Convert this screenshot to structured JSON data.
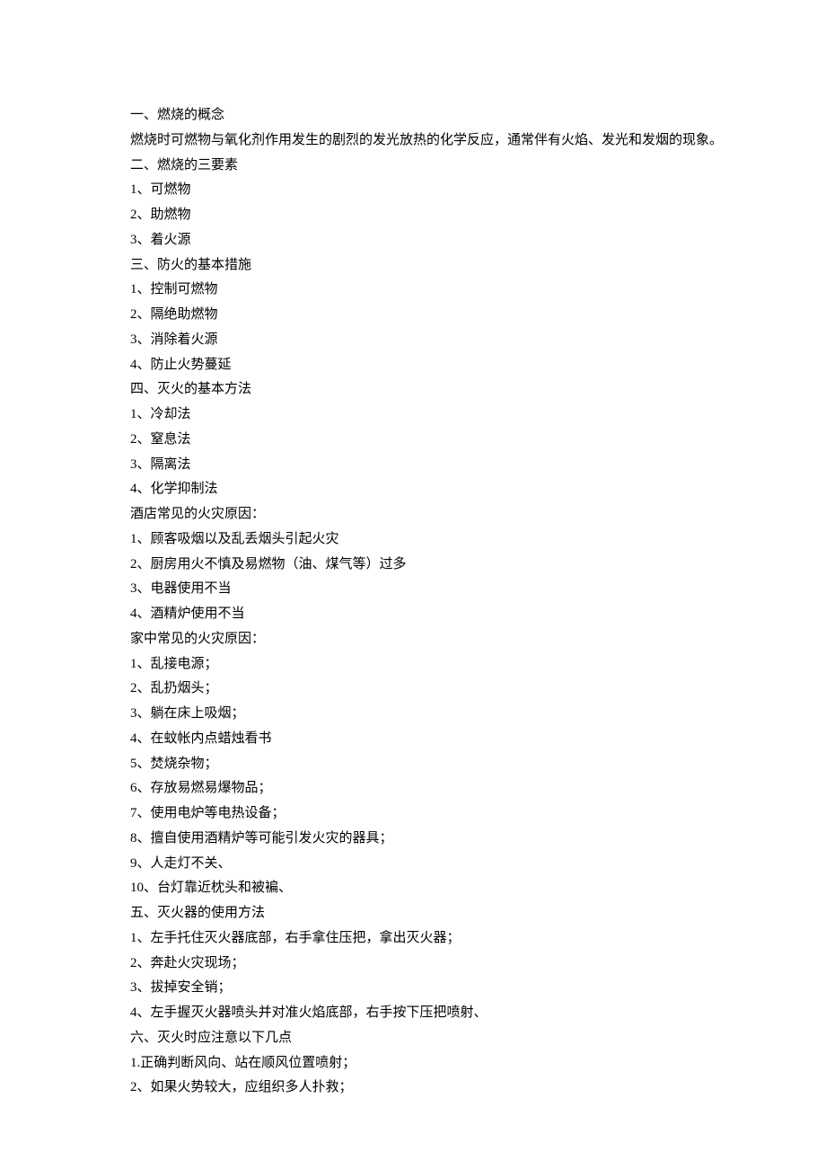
{
  "lines": [
    {
      "text": "一、燃烧的概念",
      "indent": true
    },
    {
      "text": "燃烧时可燃物与氧化剂作用发生的剧烈的发光放热的化学反应，通常伴有火焰、发光和发烟的现象。",
      "indent": true,
      "wrap": true
    },
    {
      "text": "二、燃烧的三要素",
      "indent": true
    },
    {
      "text": "1、可燃物",
      "indent": true
    },
    {
      "text": "2、助燃物",
      "indent": true
    },
    {
      "text": "3、着火源",
      "indent": true
    },
    {
      "text": "三、防火的基本措施",
      "indent": true
    },
    {
      "text": "1、控制可燃物",
      "indent": true
    },
    {
      "text": "2、隔绝助燃物",
      "indent": true
    },
    {
      "text": "3、消除着火源",
      "indent": true
    },
    {
      "text": "4、防止火势蔓延",
      "indent": true
    },
    {
      "text": "四、灭火的基本方法",
      "indent": true
    },
    {
      "text": "1、冷却法",
      "indent": true
    },
    {
      "text": "2、窒息法",
      "indent": true
    },
    {
      "text": "3、隔离法",
      "indent": true
    },
    {
      "text": "4、化学抑制法",
      "indent": true
    },
    {
      "text": "酒店常见的火灾原因：",
      "indent": true
    },
    {
      "text": "1、顾客吸烟以及乱丢烟头引起火灾",
      "indent": true
    },
    {
      "text": "2、厨房用火不慎及易燃物（油、煤气等）过多",
      "indent": true
    },
    {
      "text": "3、电器使用不当",
      "indent": true
    },
    {
      "text": "4、酒精炉使用不当",
      "indent": true
    },
    {
      "text": "家中常见的火灾原因：",
      "indent": true
    },
    {
      "text": "1、乱接电源；",
      "indent": true
    },
    {
      "text": "2、乱扔烟头；",
      "indent": true
    },
    {
      "text": "3、躺在床上吸烟；",
      "indent": true
    },
    {
      "text": "4、在蚊帐内点蜡烛看书",
      "indent": true
    },
    {
      "text": "5、焚烧杂物；",
      "indent": true
    },
    {
      "text": "6、存放易燃易爆物品；",
      "indent": true
    },
    {
      "text": "7、使用电炉等电热设备；",
      "indent": true
    },
    {
      "text": "8、擅自使用酒精炉等可能引发火灾的器具；",
      "indent": true
    },
    {
      "text": "9、人走灯不关、",
      "indent": true
    },
    {
      "text": "10、台灯靠近枕头和被褊、",
      "indent": true
    },
    {
      "text": "五、灭火器的使用方法",
      "indent": true
    },
    {
      "text": "1、左手托住灭火器底部，右手拿住压把，拿出灭火器；",
      "indent": true
    },
    {
      "text": "2、奔赴火灾现场；",
      "indent": true
    },
    {
      "text": "3、拔掉安全销；",
      "indent": true
    },
    {
      "text": "4、左手握灭火器喷头并对准火焰底部，右手按下压把喷射、",
      "indent": true
    },
    {
      "text": "六、灭火时应注意以下几点",
      "indent": true
    },
    {
      "text": "1.正确判断风向、站在顺风位置喷射；",
      "indent": true
    },
    {
      "text": "2、如果火势较大，应组织多人扑救；",
      "indent": true
    }
  ]
}
